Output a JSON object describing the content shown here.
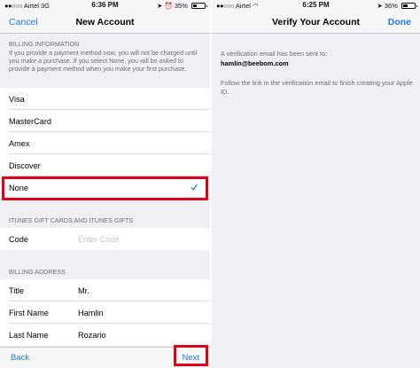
{
  "left_screen": {
    "status": {
      "carrier": "Airtel",
      "network": "3G",
      "time": "6:36 PM",
      "battery": "35%",
      "signal_dots": "●●○○○",
      "battery_level": 0.35
    },
    "nav": {
      "cancel": "Cancel",
      "title": "New Account"
    },
    "billing": {
      "header": "BILLING INFORMATION",
      "note": "If you provide a payment method now, you will not be charged until you make a purchase. If you select None, you will be asked to provide a payment method when you make your first purchase.",
      "options": [
        "Visa",
        "MasterCard",
        "Amex",
        "Discover",
        "None"
      ],
      "selected": "None"
    },
    "gift": {
      "header": "ITUNES GIFT CARDS AND ITUNES GIFTS",
      "code_label": "Code",
      "code_placeholder": "Enter Code"
    },
    "address": {
      "header": "BILLING ADDRESS",
      "fields": [
        {
          "label": "Title",
          "value": "Mr."
        },
        {
          "label": "First Name",
          "value": "Hamlin"
        },
        {
          "label": "Last Name",
          "value": "Rozario"
        }
      ]
    },
    "toolbar": {
      "back": "Back",
      "next": "Next"
    }
  },
  "right_screen": {
    "status": {
      "carrier": "Airtel",
      "time": "6:25 PM",
      "battery": "36%",
      "signal_dots": "●●○○○",
      "battery_level": 0.36
    },
    "nav": {
      "title": "Verify Your Account",
      "done": "Done"
    },
    "message": "A verification email has been sent to:",
    "email": "hamlin@beebom.com",
    "instruction": "Follow the link in the verification email to finish creating your Apple ID."
  },
  "colors": {
    "accent": "#1f7aed",
    "highlight": "#e0001a",
    "background": "#efeff4"
  }
}
